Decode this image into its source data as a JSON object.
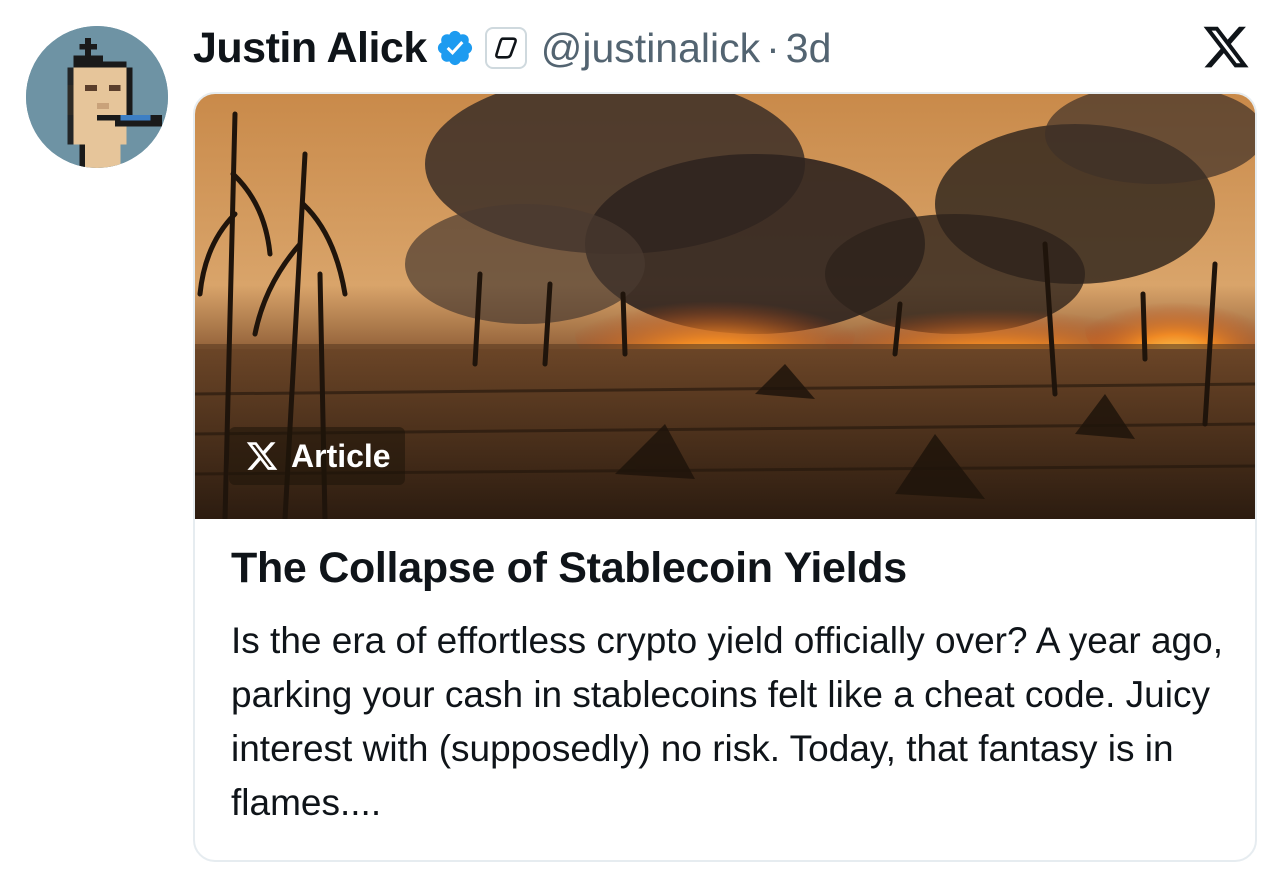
{
  "author": {
    "display_name": "Justin Alick",
    "handle": "@justinalick",
    "separator": "·",
    "time_ago": "3d"
  },
  "icons": {
    "avatar": "pixel-punk-avatar",
    "verified": "verified-badge-icon",
    "affiliate": "affiliate-badge-icon",
    "platform": "x-logo-icon"
  },
  "colors": {
    "verified": "#1d9bf0",
    "secondary_text": "#536471",
    "primary_text": "#0f1419"
  },
  "article": {
    "badge_label": "Article",
    "title": "The Collapse of Stablecoin Yields",
    "excerpt": "Is the era of effortless crypto yield officially over? A year ago, parking your cash in stablecoins felt like a cheat code. Juicy interest with (supposedly) no risk. Today, that fantasy is in flames...."
  }
}
